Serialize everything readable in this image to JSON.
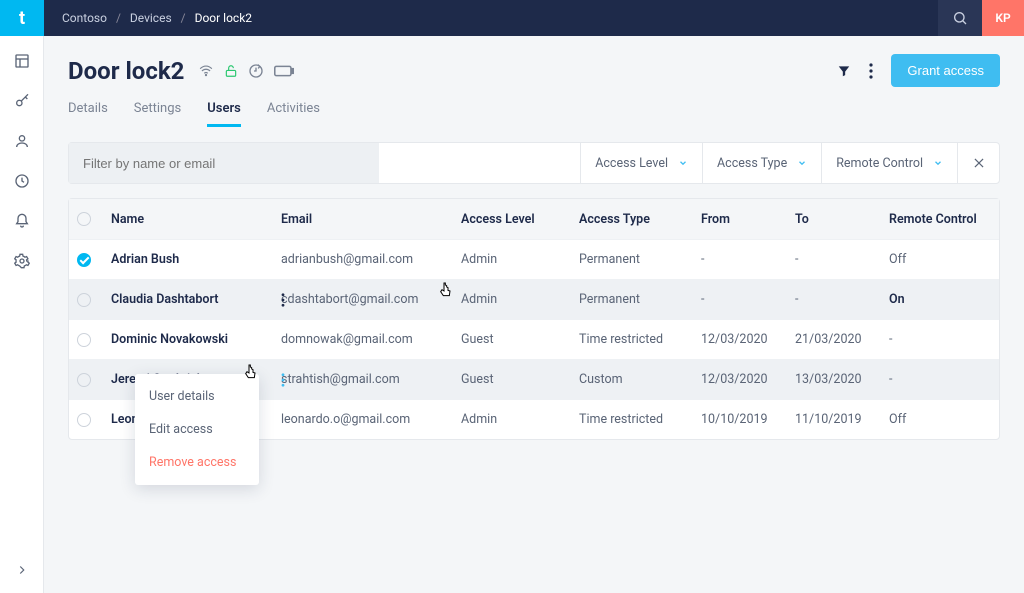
{
  "topbar": {
    "logo_letter": "t",
    "avatar_initials": "KP"
  },
  "breadcrumb": {
    "root": "Contoso",
    "mid": "Devices",
    "current": "Door lock2"
  },
  "page": {
    "title": "Door lock2",
    "grant_label": "Grant access"
  },
  "tabs": [
    {
      "label": "Details"
    },
    {
      "label": "Settings"
    },
    {
      "label": "Users",
      "active": true
    },
    {
      "label": "Activities"
    }
  ],
  "filters": {
    "input_placeholder": "Filter by name or email",
    "dd1": "Access Level",
    "dd2": "Access Type",
    "dd3": "Remote Control"
  },
  "table": {
    "headers": {
      "name": "Name",
      "email": "Email",
      "level": "Access Level",
      "type": "Access Type",
      "from": "From",
      "to": "To",
      "remote": "Remote Control"
    },
    "rows": [
      {
        "name": "Adrian Bush",
        "email": "adrianbush@gmail.com",
        "level": "Admin",
        "type": "Permanent",
        "from": "-",
        "to": "-",
        "remote": "Off",
        "selected": true
      },
      {
        "name": "Claudia Dashtabort",
        "email": "cdashtabort@gmail.com",
        "level": "Admin",
        "type": "Permanent",
        "from": "-",
        "to": "-",
        "remote": "On",
        "hovered": true,
        "menu_dark": true
      },
      {
        "name": "Dominic Novakowski",
        "email": "domnowak@gmail.com",
        "level": "Guest",
        "type": "Time restricted",
        "from": "12/03/2020",
        "to": "21/03/2020",
        "remote": "-"
      },
      {
        "name": "Jeremi Strahtish",
        "email": "strahtish@gmail.com",
        "level": "Guest",
        "type": "Custom",
        "from": "12/03/2020",
        "to": "13/03/2020",
        "remote": "-",
        "hovered": true,
        "menu_accent": true
      },
      {
        "name": "Leona",
        "email": "leonardo.o@gmail.com",
        "level": "Admin",
        "type": "Time restricted",
        "from": "10/10/2019",
        "to": "11/10/2019",
        "remote": "Off"
      }
    ]
  },
  "context_menu": {
    "item1": "User details",
    "item2": "Edit access",
    "item3": "Remove access"
  }
}
